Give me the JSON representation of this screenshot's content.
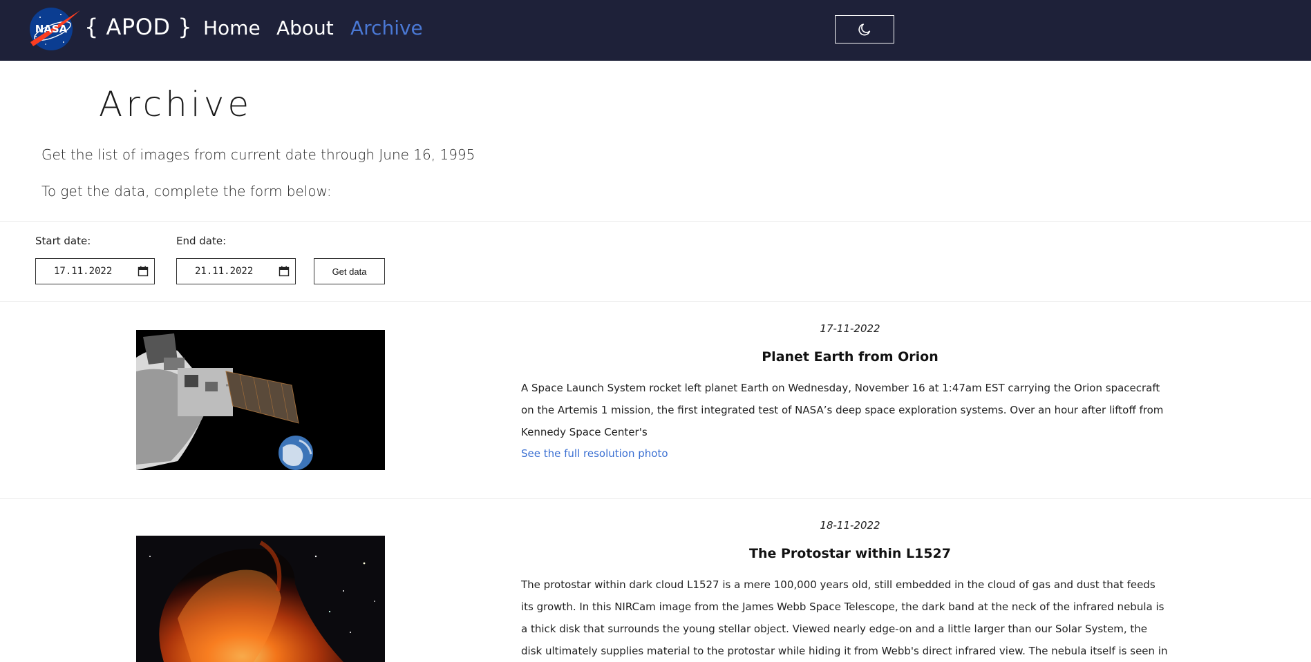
{
  "nav": {
    "brand": "{ APOD }",
    "logo_text": "NASA",
    "links": [
      "Home",
      "About",
      "Archive"
    ],
    "active": "Archive"
  },
  "page": {
    "title": "Archive",
    "intro_1": "Get the list of images from current date through June 16, 1995",
    "intro_2": "To get the data, complete the form below:"
  },
  "form": {
    "start_label": "Start date:",
    "start_value": "17.11.2022",
    "end_label": "End date:",
    "end_value": "21.11.2022",
    "submit_label": "Get data"
  },
  "entries": [
    {
      "date": "17-11-2022",
      "title": "Planet Earth from Orion",
      "text": "A Space Launch System rocket left planet Earth on Wednesday, November 16 at 1:47am EST carrying the Orion spacecraft on the Artemis 1 mission, the first integrated test of NASA’s deep space exploration systems. Over an hour after liftoff from Kennedy Space Center's",
      "link": "See the full resolution photo"
    },
    {
      "date": "18-11-2022",
      "title": "The Protostar within L1527",
      "text": "The protostar within dark cloud L1527 is a mere 100,000 years old, still embedded in the cloud of gas and dust that feeds its growth. In this NIRCam image from the James Webb Space Telescope, the dark band at the neck of the infrared nebula is a thick disk that surrounds the young stellar object. Viewed nearly edge-on and a little larger than our Solar System, the disk ultimately supplies material to the protostar while hiding it from Webb's direct infrared view. The nebula itself is seen in stunning detail"
    }
  ],
  "colors": {
    "navbar_bg": "#1e2139",
    "accent": "#4a78d4",
    "link": "#3a6fd2"
  },
  "icons": {
    "theme_toggle": "moon-icon",
    "date_picker": "calendar-icon"
  }
}
